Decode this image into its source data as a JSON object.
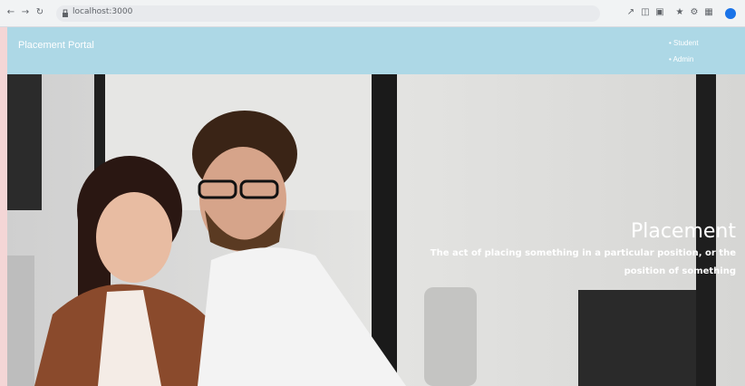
{
  "browser": {
    "url": "localhost:3000",
    "back_icon": "arrow-left-icon",
    "forward_icon": "arrow-right-icon",
    "reload_icon": "reload-icon",
    "toolbar_icons": [
      "share-icon",
      "translate-icon",
      "extension-icon",
      "bookmark-star-icon",
      "settings-icon",
      "puzzle-icon"
    ]
  },
  "header": {
    "brand": "Placement Portal",
    "nav": [
      "Student",
      "Admin"
    ],
    "background": "#add8e6"
  },
  "hero": {
    "title": "Placement",
    "subtitle": "The act of placing something in a particular position, or the position of something"
  }
}
